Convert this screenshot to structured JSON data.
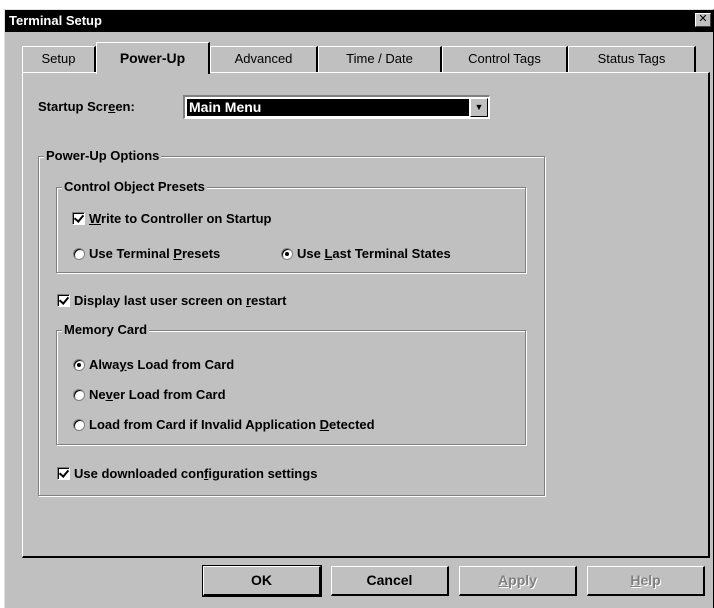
{
  "window": {
    "title": "Terminal Setup",
    "close_glyph": "✕"
  },
  "tabs": [
    {
      "label": "Setup"
    },
    {
      "label": "Power-Up"
    },
    {
      "label": "Advanced"
    },
    {
      "label": "Time / Date"
    },
    {
      "label": "Control Tags"
    },
    {
      "label": "Status Tags"
    }
  ],
  "active_tab": "Power-Up",
  "startup": {
    "label_pre": "Startup Scr",
    "label_key": "e",
    "label_post": "en:",
    "value": "Main Menu"
  },
  "power_up_options": {
    "title": "Power-Up Options"
  },
  "control_object_presets": {
    "title": "Control Object Presets",
    "write_to_controller": {
      "key": "W",
      "rest": "rite to Controller on Startup",
      "checked": true
    },
    "use_terminal_presets": {
      "pre": "Use Terminal ",
      "key": "P",
      "post": "resets",
      "selected": false
    },
    "use_last_states": {
      "pre": "Use ",
      "key": "L",
      "post": "ast Terminal States",
      "selected": true
    }
  },
  "display_last_screen": {
    "pre": "Display last user screen on ",
    "key": "r",
    "post": "estart",
    "checked": true
  },
  "memory_card": {
    "title": "Memory Card",
    "always": {
      "pre": "Alwa",
      "key": "y",
      "post": "s Load from Card",
      "selected": true
    },
    "never": {
      "pre": "Ne",
      "key": "v",
      "post": "er Load from Card",
      "selected": false
    },
    "invalid": {
      "pre": "Load from Card if Invalid Application ",
      "key": "D",
      "post": "etected",
      "selected": false
    }
  },
  "use_downloaded": {
    "pre": "Use downloaded con",
    "key": "f",
    "post": "iguration settings",
    "checked": true
  },
  "buttons": {
    "ok": {
      "label": "OK"
    },
    "cancel": {
      "label": "Cancel"
    },
    "apply": {
      "pre": "",
      "key": "A",
      "post": "pply"
    },
    "help": {
      "pre": "",
      "key": "H",
      "post": "elp"
    }
  }
}
